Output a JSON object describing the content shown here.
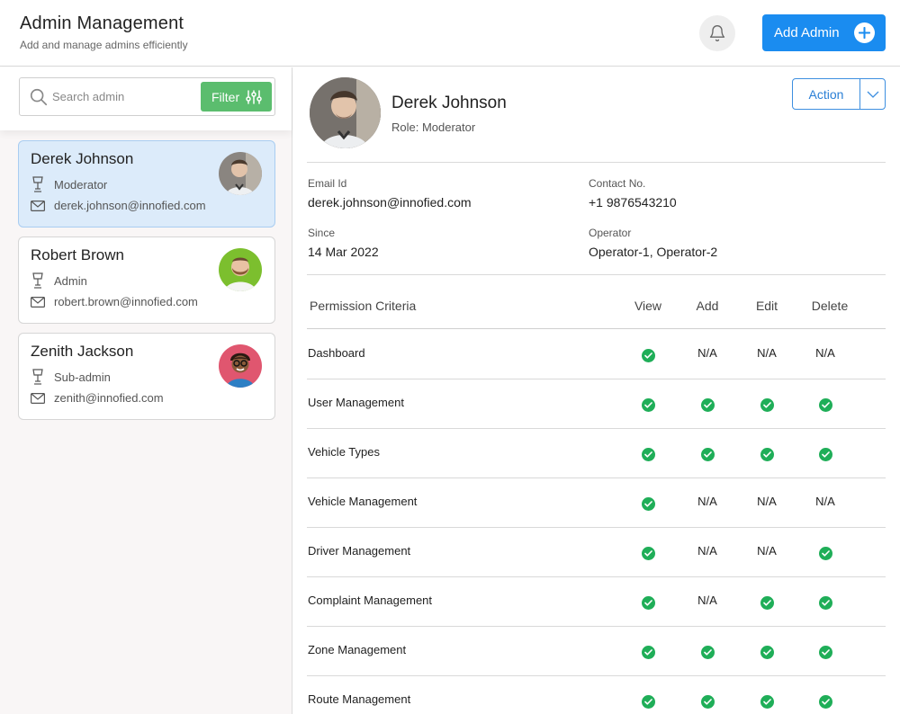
{
  "header": {
    "title": "Admin Management",
    "subtitle": "Add and manage admins efficiently",
    "add_button_label": "Add Admin"
  },
  "sidebar": {
    "search_placeholder": "Search admin",
    "filter_label": "Filter",
    "admins": [
      {
        "name": "Derek Johnson",
        "role": "Moderator",
        "email": "derek.johnson@innofied.com"
      },
      {
        "name": "Robert Brown",
        "role": "Admin",
        "email": "robert.brown@innofied.com"
      },
      {
        "name": "Zenith Jackson",
        "role": "Sub-admin",
        "email": "zenith@innofied.com"
      }
    ]
  },
  "detail": {
    "name": "Derek Johnson",
    "role": "Role: Moderator",
    "action_label": "Action",
    "email_label": "Email Id",
    "email": "derek.johnson@innofied.com",
    "contact_label": "Contact No.",
    "contact": "+1 9876543210",
    "since_label": "Since",
    "since": "14 Mar 2022",
    "operator_label": "Operator",
    "operator": "Operator-1, Operator-2"
  },
  "permissions": {
    "headers": [
      "Permission Criteria",
      "View",
      "Add",
      "Edit",
      "Delete"
    ],
    "rows": [
      {
        "name": "Dashboard",
        "cells": [
          "check",
          "N/A",
          "N/A",
          "N/A"
        ]
      },
      {
        "name": "User Management",
        "cells": [
          "check",
          "check",
          "check",
          "check"
        ]
      },
      {
        "name": "Vehicle Types",
        "cells": [
          "check",
          "check",
          "check",
          "check"
        ]
      },
      {
        "name": "Vehicle Management",
        "cells": [
          "check",
          "N/A",
          "N/A",
          "N/A"
        ]
      },
      {
        "name": "Driver Management",
        "cells": [
          "check",
          "N/A",
          "N/A",
          "check"
        ]
      },
      {
        "name": "Complaint Management",
        "cells": [
          "check",
          "N/A",
          "check",
          "check"
        ]
      },
      {
        "name": "Zone Management",
        "cells": [
          "check",
          "check",
          "check",
          "check"
        ]
      },
      {
        "name": "Route Management",
        "cells": [
          "check",
          "check",
          "check",
          "check"
        ]
      }
    ]
  },
  "colors": {
    "primary": "#1a8cf0",
    "filter_green": "#5bbd6e",
    "check_green": "#1fae58",
    "active_card": "#dcebfa"
  },
  "icons": [
    "bell-icon",
    "plus-circle-icon",
    "search-icon",
    "filter-sliders-icon",
    "role-icon",
    "mail-icon",
    "chevron-down-icon",
    "check-circle-icon"
  ]
}
